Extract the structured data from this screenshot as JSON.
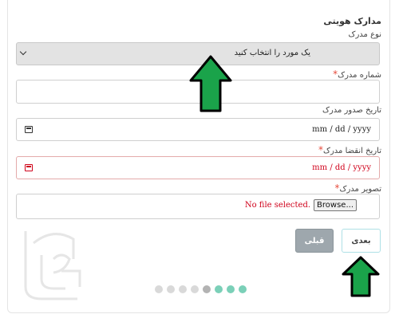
{
  "section": {
    "title": "مدارک هویتی"
  },
  "doc_type": {
    "label": "نوع مدرک",
    "selected": "یک مورد را انتخاب کنید"
  },
  "doc_number": {
    "label": "شماره مدرک",
    "required_mark": "*",
    "value": ""
  },
  "issue_date": {
    "label": "تاریخ صدور مدرک",
    "value": "mm / dd / yyyy"
  },
  "expiry_date": {
    "label": "تاریخ انقضا مدرک",
    "required_mark": "*",
    "value": "mm / dd / yyyy"
  },
  "doc_image": {
    "label": "تصویر مدرک",
    "required_mark": "*",
    "browse_label": "Browse...",
    "status": "No file selected."
  },
  "buttons": {
    "prev": "قبلی",
    "next": "بعدی"
  },
  "progress": {
    "total": 8,
    "current": 5,
    "completed_after": 3
  },
  "colors": {
    "required": "#e74c3c",
    "error": "#d0021b",
    "arrow": "#1aa34a",
    "step_done": "#7bd0b8"
  },
  "icons": [
    "chevron-down-icon",
    "calendar-icon",
    "arrow-up-icon",
    "watermark-logo"
  ]
}
